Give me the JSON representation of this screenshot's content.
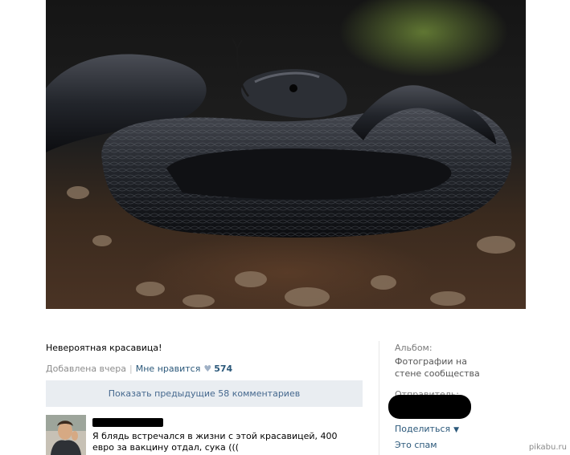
{
  "post": {
    "caption": "Невероятная красавица!",
    "added": "Добавлена вчера",
    "like_label": "Мне нравится",
    "like_count": "574",
    "show_previous": "Показать предыдущие 58 комментариев"
  },
  "comment": {
    "text": "Я блядь встречался в жизни с этой красавицей, 400 евро за вакцину отдал, сука (((",
    "author": "",
    "author_redacted": true
  },
  "sidebar": {
    "album_label": "Альбом:",
    "album_link": "Фотографии на стене сообщества",
    "sender_label": "Отправитель:",
    "share_label": "Поделиться",
    "spam_label": "Это спам"
  },
  "watermark": "pikabu.ru",
  "icons": {
    "like": "heart-icon",
    "share": "chevron-down-icon"
  },
  "colors": {
    "link": "#2b587a",
    "muted": "#8c8c8c",
    "button_bg": "#e9edf1",
    "button_text": "#45688e"
  }
}
